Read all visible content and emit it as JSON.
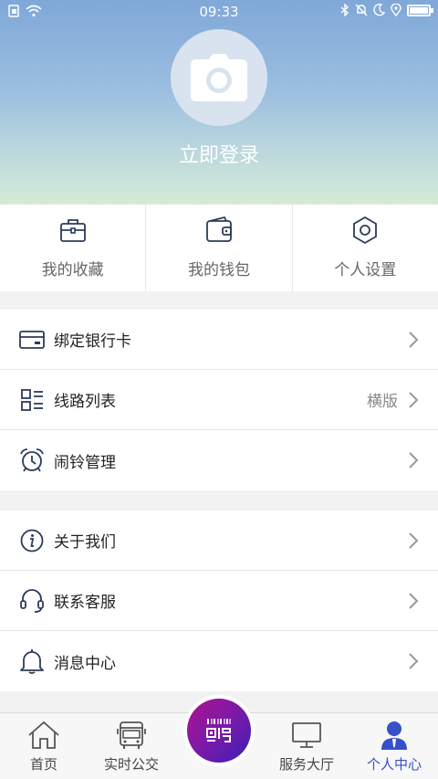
{
  "status_bar": {
    "time": "09:33",
    "battery_level": 0.9
  },
  "header": {
    "login_label": "立即登录"
  },
  "quick_actions": [
    {
      "label": "我的收藏",
      "icon": "briefcase-icon"
    },
    {
      "label": "我的钱包",
      "icon": "wallet-icon"
    },
    {
      "label": "个人设置",
      "icon": "settings-icon"
    }
  ],
  "group1": [
    {
      "label": "绑定银行卡",
      "icon": "bank-card-icon",
      "extra": ""
    },
    {
      "label": "线路列表",
      "icon": "list-icon",
      "extra": "横版"
    },
    {
      "label": "闹铃管理",
      "icon": "alarm-clock-icon",
      "extra": ""
    }
  ],
  "group2": [
    {
      "label": "关于我们",
      "icon": "info-icon",
      "extra": ""
    },
    {
      "label": "联系客服",
      "icon": "headset-icon",
      "extra": ""
    },
    {
      "label": "消息中心",
      "icon": "bell-icon",
      "extra": ""
    }
  ],
  "tabbar": {
    "items": [
      {
        "label": "首页",
        "icon": "home-icon"
      },
      {
        "label": "实时公交",
        "icon": "bus-icon"
      },
      {
        "label": "服务大厅",
        "icon": "monitor-icon"
      },
      {
        "label": "个人中心",
        "icon": "user-icon"
      }
    ],
    "active": "个人中心",
    "scan_icon": "qr-scan-icon"
  },
  "colors": {
    "accent": "#3550c8",
    "icon_stroke": "#2c3b58",
    "scan_gradient_start": "#b0128f",
    "scan_gradient_end": "#3c1fb6"
  }
}
